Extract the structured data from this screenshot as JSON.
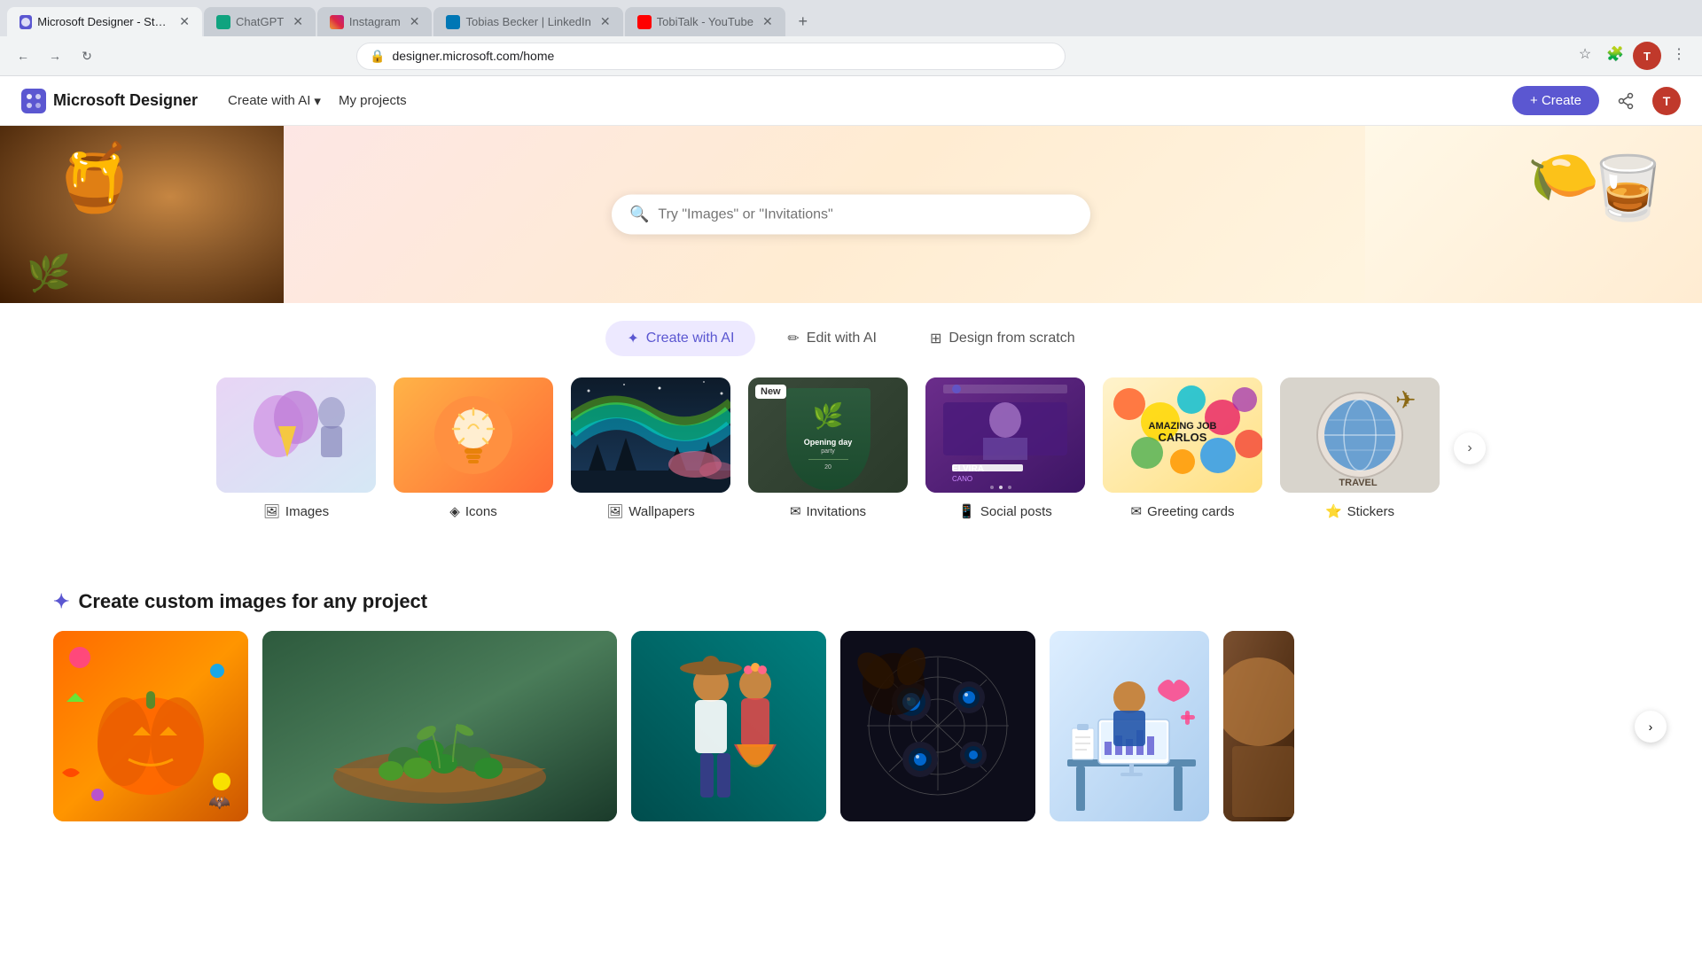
{
  "browser": {
    "tabs": [
      {
        "label": "Microsoft Designer - Stunning",
        "favicon_color": "#5b57d1",
        "active": true
      },
      {
        "label": "ChatGPT",
        "favicon_color": "#10a37f",
        "active": false
      },
      {
        "label": "Instagram",
        "favicon_color": "#e1306c",
        "active": false
      },
      {
        "label": "Tobias Becker | LinkedIn",
        "favicon_color": "#0077b5",
        "active": false
      },
      {
        "label": "TobiTalk - YouTube",
        "favicon_color": "#ff0000",
        "active": false
      }
    ],
    "url": "designer.microsoft.com/home"
  },
  "header": {
    "logo_text": "Microsoft Designer",
    "nav_items": [
      {
        "label": "Create with AI",
        "has_dropdown": true
      },
      {
        "label": "My projects",
        "has_dropdown": false
      }
    ],
    "create_btn": "+ Create"
  },
  "search": {
    "placeholder": "Try \"Images\" or \"Invitations\""
  },
  "tabs": [
    {
      "label": "Create with AI",
      "active": true
    },
    {
      "label": "Edit with AI",
      "active": false
    },
    {
      "label": "Design from scratch",
      "active": false
    }
  ],
  "categories": [
    {
      "label": "Images",
      "type": "images"
    },
    {
      "label": "Icons",
      "type": "icons"
    },
    {
      "label": "Wallpapers",
      "type": "wallpapers"
    },
    {
      "label": "Invitations",
      "type": "invitations",
      "is_new": true
    },
    {
      "label": "Social posts",
      "type": "social"
    },
    {
      "label": "Greeting cards",
      "type": "greeting"
    },
    {
      "label": "Stickers",
      "type": "stickers"
    }
  ],
  "custom_section": {
    "title": "Create custom images for any project",
    "images": [
      {
        "alt": "Halloween pumpkin",
        "type": "pumpkin"
      },
      {
        "alt": "Olives in bowl",
        "type": "olives"
      },
      {
        "alt": "Mexican couple",
        "type": "couple"
      },
      {
        "alt": "Spider web with eyes",
        "type": "spider"
      },
      {
        "alt": "Medical illustration",
        "type": "medical"
      },
      {
        "alt": "Partial image",
        "type": "partial"
      }
    ]
  },
  "icons": {
    "search": "🔍",
    "dropdown": "▾",
    "plus": "+",
    "share": "⤴",
    "person": "👤",
    "ai_sparkle": "✦",
    "edit_pencil": "✏",
    "design_grid": "⊞",
    "arrow_right": "›",
    "star": "⭐",
    "section_icon": "✦"
  }
}
